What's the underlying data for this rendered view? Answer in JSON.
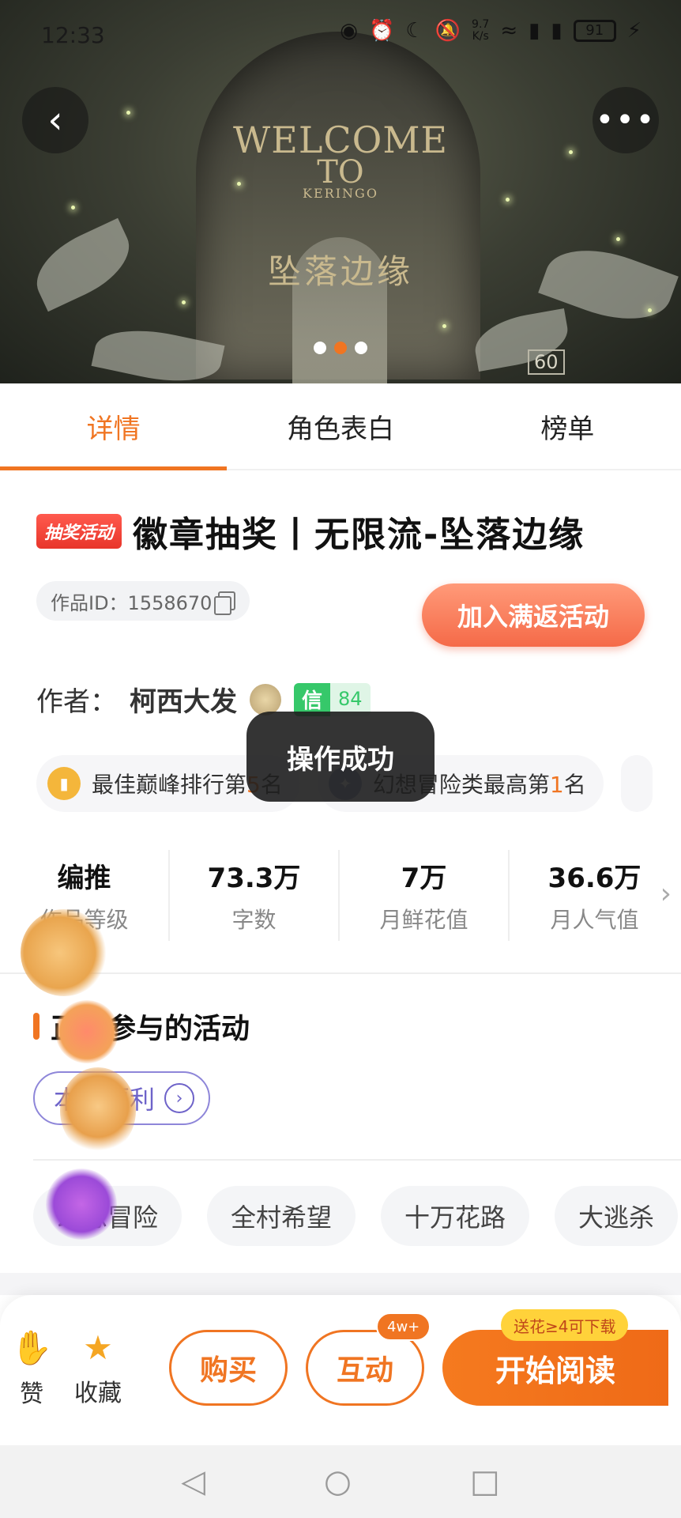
{
  "status_bar": {
    "time": "12:33",
    "speed_value": "9.7",
    "speed_unit": "K/s",
    "battery": "91"
  },
  "hero": {
    "welcome": "WELCOME",
    "to": "TO",
    "kering": "KERINGO",
    "cn_title": "坠落边缘",
    "corner_number": "60",
    "carousel_total": 3,
    "carousel_active": 2
  },
  "tabs": [
    {
      "label": "详情",
      "active": true
    },
    {
      "label": "角色表白",
      "active": false
    },
    {
      "label": "榜单",
      "active": false
    }
  ],
  "book": {
    "tag": "抽奖活动",
    "title": "徽章抽奖丨无限流-坠落边缘",
    "id_text": "作品ID：1558670",
    "join_label": "加入满返活动",
    "author_label": "作者：",
    "author_name": "柯西大发",
    "trust_key": "信",
    "trust_value": "84"
  },
  "ranks": [
    {
      "prefix": "最佳巅峰排行第",
      "num": "5",
      "suffix": "名"
    },
    {
      "prefix": "幻想冒险类最高第",
      "num": "1",
      "suffix": "名"
    }
  ],
  "toast": "操作成功",
  "stats": [
    {
      "value": "编推",
      "label": "作品等级"
    },
    {
      "value": "73.3万",
      "label": "字数"
    },
    {
      "value": "7万",
      "label": "月鲜花值"
    },
    {
      "value": "36.6万",
      "label": "月人气值"
    }
  ],
  "activities": {
    "title": "正在参与的活动",
    "pill": "本周福利"
  },
  "genres": [
    "幻想冒险",
    "全村希望",
    "十万花路",
    "大逃杀"
  ],
  "bottom": {
    "like": "赞",
    "favorite": "收藏",
    "buy": "购买",
    "interact": "互动",
    "interact_badge": "4w+",
    "read": "开始阅读",
    "read_badge": "送花≥4可下载"
  },
  "colors": {
    "accent": "#f07522",
    "trust": "#36c86a",
    "activity": "#6e63c9"
  }
}
